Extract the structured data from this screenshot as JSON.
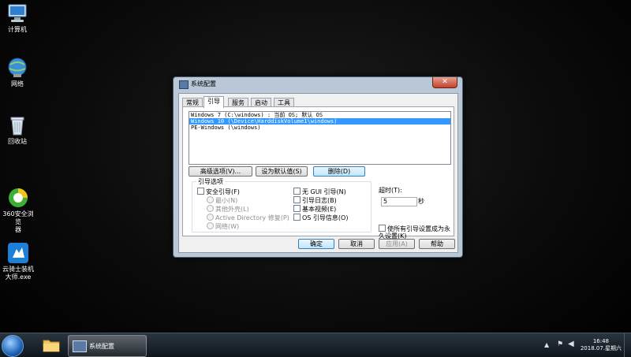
{
  "desktop": {
    "icons": [
      {
        "label": "计算机",
        "icon": "computer-icon"
      },
      {
        "label": "网络",
        "icon": "network-icon"
      },
      {
        "label": "回收站",
        "icon": "recycle-bin-icon"
      },
      {
        "label": "360安全浏览\n器",
        "icon": "browser-360-icon"
      },
      {
        "label": "云骑士装机\n大师.exe",
        "icon": "yunqishi-icon"
      }
    ]
  },
  "window": {
    "title": "系统配置",
    "close_label": "✕",
    "tabs": [
      "常规",
      "引导",
      "服务",
      "启动",
      "工具"
    ],
    "active_tab": 1,
    "os_entries": [
      "Windows 7 (C:\\windows) : 当前 OS; 默认 OS",
      "Windows 10 (\\Device\\HarddiskVolume1\\windows)",
      "PE-Windows (\\windows)"
    ],
    "selected_entry": 1,
    "buttons": {
      "advanced": "高级选项(V)...",
      "set_default": "设为默认值(S)",
      "delete": "删除(D)"
    },
    "boot_options": {
      "group_title": "引导选项",
      "safe_boot": "安全引导(F)",
      "minimal": "最小(N)",
      "alternate_shell": "其他外壳(L)",
      "ad_repair": "Active Directory 修复(P)",
      "network": "网络(W)",
      "no_gui": "无 GUI 引导(N)",
      "boot_log": "引导日志(B)",
      "base_video": "基本视频(E)",
      "os_info": "OS 引导信息(O)"
    },
    "timeout": {
      "label": "超时(T):",
      "value": "5",
      "unit": "秒"
    },
    "permanent": "使所有引导设置成为永久设置(K)",
    "footer": {
      "ok": "确定",
      "cancel": "取消",
      "apply": "应用(A)",
      "help": "帮助"
    }
  },
  "taskbar": {
    "app_label": "系统配置",
    "time": "16:48",
    "date": "2018.07.星期六"
  },
  "colors": {
    "selection": "#3399ff",
    "window_frame": "#b9c7d6"
  }
}
